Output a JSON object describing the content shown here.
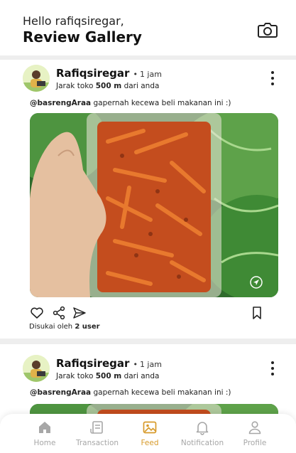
{
  "header": {
    "greeting": "Hello rafiqsiregar,",
    "title": "Review Gallery",
    "camera_icon": "camera-icon"
  },
  "posts": [
    {
      "username": "Rafiqsiregar",
      "separator": "•",
      "time": "1 jam",
      "distance_prefix": "Jarak toko",
      "distance_value": "500 m",
      "distance_suffix": "dari anda",
      "caption_user": "@basrengAraa",
      "caption_text": "gapernah kecewa beli makanan ini :)",
      "likes_prefix": "Disukai oleh",
      "likes_count": "2 user"
    },
    {
      "username": "Rafiqsiregar",
      "separator": "•",
      "time": "1 jam",
      "distance_prefix": "Jarak toko",
      "distance_value": "500 m",
      "distance_suffix": "dari anda",
      "caption_user": "@basrengAraa",
      "caption_text": "gapernah kecewa beli makanan ini :)"
    }
  ],
  "bottom_nav": {
    "active": "Feed",
    "active_color": "#d79a2a",
    "inactive_color": "#a7a7a7",
    "items": [
      {
        "label": "Home",
        "icon": "home-icon"
      },
      {
        "label": "Transaction",
        "icon": "receipt-icon"
      },
      {
        "label": "Feed",
        "icon": "image-icon"
      },
      {
        "label": "Notification",
        "icon": "bell-icon"
      },
      {
        "label": "Profile",
        "icon": "user-icon"
      }
    ]
  }
}
